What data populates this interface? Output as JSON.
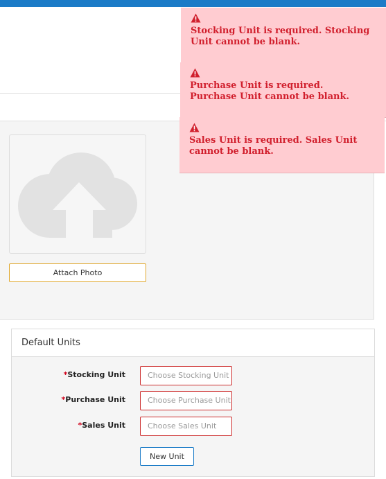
{
  "photo": {
    "attach_label": "Attach Photo"
  },
  "default_units": {
    "title": "Default Units",
    "required_marker": "*",
    "fields": [
      {
        "label": "Stocking Unit",
        "placeholder": "Choose Stocking Unit"
      },
      {
        "label": "Purchase Unit",
        "placeholder": "Choose Purchase Unit"
      },
      {
        "label": "Sales Unit",
        "placeholder": "Choose Sales Unit"
      }
    ],
    "new_unit_label": "New Unit"
  },
  "errors": [
    {
      "message": "Stocking Unit is required. Stocking Unit cannot be blank."
    },
    {
      "message": "Purchase Unit is required. Purchase Unit cannot be blank."
    },
    {
      "message": "Sales Unit is required. Sales Unit cannot be blank."
    }
  ],
  "colors": {
    "top_bar": "#1b7bc7",
    "error_bg": "#ffccd1",
    "error_text": "#d11f2d",
    "attach_border": "#e0a82e"
  }
}
